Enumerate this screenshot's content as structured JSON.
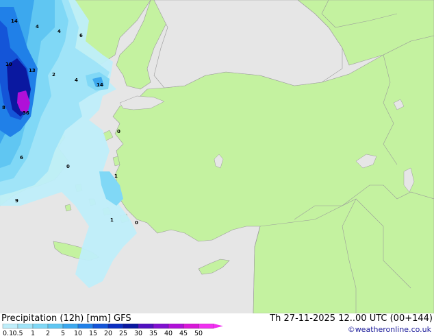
{
  "header": {
    "title_left": "Precipitation (12h) [mm] GFS",
    "title_right": "Th 27-11-2025 12..00 UTC (00+144)",
    "credit": "©weatheronline.co.uk"
  },
  "legend": {
    "labels": [
      "0.1",
      "0.5",
      "1",
      "2",
      "5",
      "10",
      "15",
      "20",
      "25",
      "30",
      "35",
      "40",
      "45",
      "50"
    ],
    "colors": [
      "#bfeefa",
      "#a0e4f8",
      "#80d8f6",
      "#60c6f2",
      "#3ca8ee",
      "#2080e8",
      "#1455d8",
      "#0a2ec0",
      "#0a18a0",
      "#5010c0",
      "#8010d0",
      "#b010d8",
      "#d818d8",
      "#f030f0"
    ]
  },
  "map_labels": [
    {
      "text": "14"
    },
    {
      "text": "4"
    },
    {
      "text": "4"
    },
    {
      "text": "6"
    },
    {
      "text": "10"
    },
    {
      "text": "13"
    },
    {
      "text": "2"
    },
    {
      "text": "4"
    },
    {
      "text": "14"
    },
    {
      "text": "8"
    },
    {
      "text": "36"
    },
    {
      "text": "0"
    },
    {
      "text": "6"
    },
    {
      "text": "0"
    },
    {
      "text": "1"
    },
    {
      "text": "9"
    },
    {
      "text": "1"
    },
    {
      "text": "0"
    }
  ],
  "colors": {
    "land": "#c4f2a0",
    "sea": "#e8e8e8",
    "border": "#a0a0a0"
  }
}
